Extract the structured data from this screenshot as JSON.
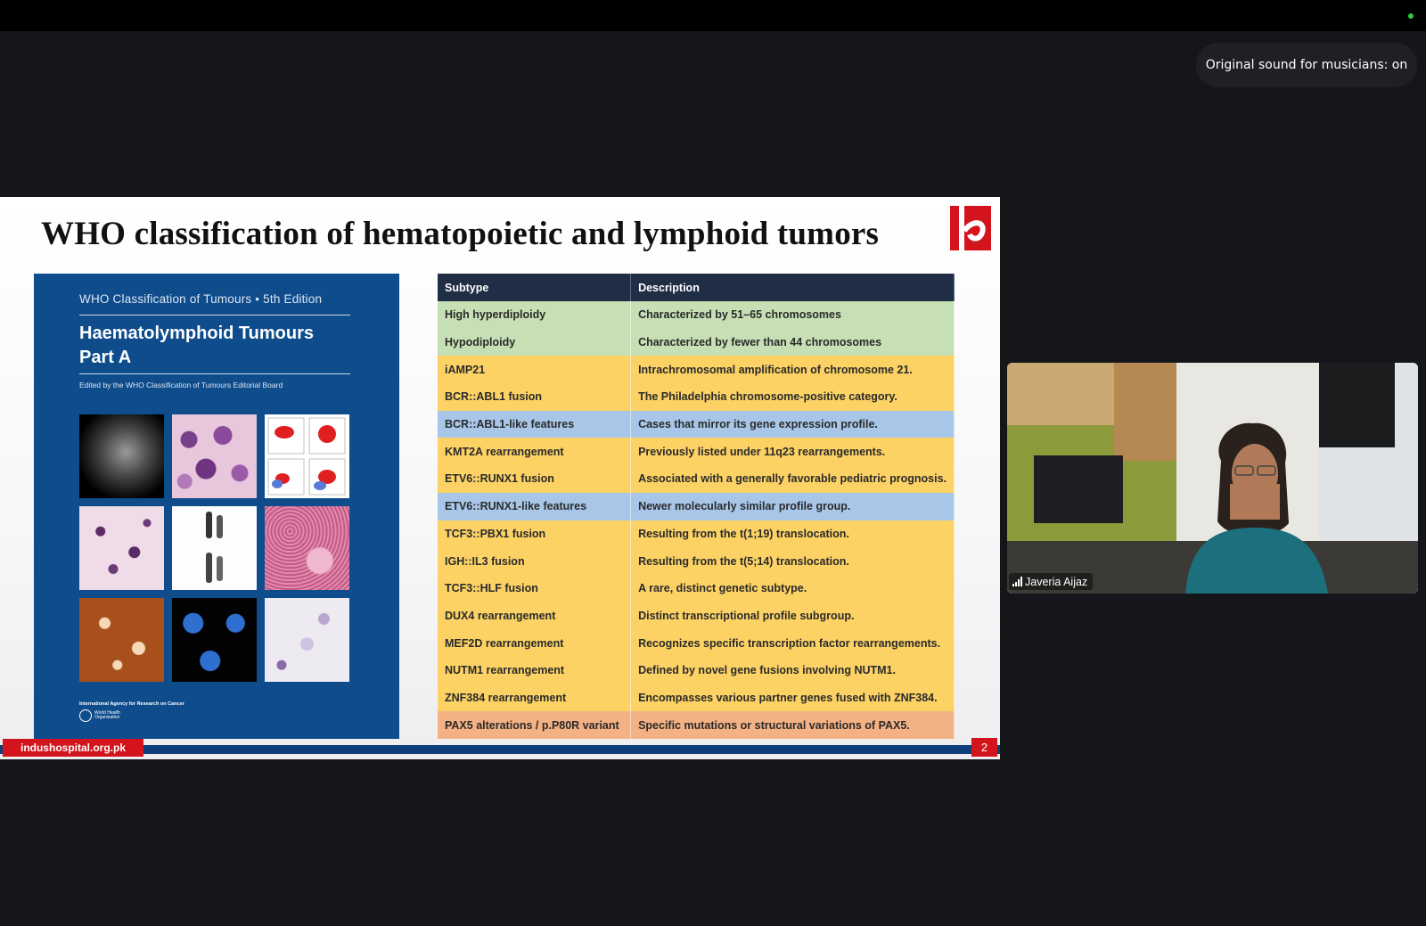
{
  "meeting": {
    "sound_status": "Original sound for musicians: on"
  },
  "slide": {
    "title": "WHO classification of hematopoietic and lymphoid tumors",
    "website": "indushospital.org.pk",
    "page_number": "2",
    "logo_color": "#d3141c",
    "cover": {
      "series": "WHO Classification of Tumours  •  5th Edition",
      "title": "Haematolymphoid Tumours\nPart A",
      "editor": "Edited by the WHO Classification of Tumours Editorial Board",
      "publisher": "International Agency for Research on Cancer",
      "org": "World Health\nOrganization",
      "color": "#0e4c8c"
    },
    "table": {
      "headers": [
        "Subtype",
        "Description"
      ],
      "rows": [
        {
          "subtype": "High hyperdiploidy",
          "description": "Characterized by 51–65 chromosomes",
          "color": "#c6dfb4"
        },
        {
          "subtype": "Hypodiploidy",
          "description": "Characterized by fewer than 44 chromosomes",
          "color": "#c6dfb4"
        },
        {
          "subtype": "iAMP21",
          "description": "Intrachromosomal amplification of chromosome 21.",
          "color": "#fcd265"
        },
        {
          "subtype": "BCR::ABL1 fusion",
          "description": "The Philadelphia chromosome-positive category.",
          "color": "#fcd265"
        },
        {
          "subtype": "BCR::ABL1-like features",
          "description": "Cases that mirror its gene expression profile.",
          "color": "#a7c6e8"
        },
        {
          "subtype": "KMT2A rearrangement",
          "description": "Previously listed under 11q23 rearrangements.",
          "color": "#fcd265"
        },
        {
          "subtype": "ETV6::RUNX1 fusion",
          "description": "Associated with a generally favorable pediatric prognosis.",
          "color": "#fcd265"
        },
        {
          "subtype": "ETV6::RUNX1-like features",
          "description": "Newer molecularly similar profile group.",
          "color": "#a7c6e8"
        },
        {
          "subtype": "TCF3::PBX1 fusion",
          "description": "Resulting from the t(1;19) translocation.",
          "color": "#fcd265"
        },
        {
          "subtype": "IGH::IL3 fusion",
          "description": "Resulting from the t(5;14) translocation.",
          "color": "#fcd265"
        },
        {
          "subtype": "TCF3::HLF fusion",
          "description": "A rare, distinct genetic subtype.",
          "color": "#fcd265"
        },
        {
          "subtype": "DUX4 rearrangement",
          "description": "Distinct transcriptional profile subgroup.",
          "color": "#fcd265"
        },
        {
          "subtype": "MEF2D rearrangement",
          "description": "Recognizes specific transcription factor rearrangements.",
          "color": "#fcd265"
        },
        {
          "subtype": "NUTM1 rearrangement",
          "description": "Defined by novel gene fusions involving NUTM1.",
          "color": "#fcd265"
        },
        {
          "subtype": "ZNF384 rearrangement",
          "description": "Encompasses various partner genes fused with ZNF384.",
          "color": "#fcd265"
        },
        {
          "subtype": "PAX5 alterations / p.P80R variant",
          "description": "Specific mutations or structural variations of PAX5.",
          "color": "#f4b183"
        }
      ]
    }
  },
  "participant": {
    "name": "Javeria Aijaz",
    "icon": "signal-bars-icon"
  }
}
